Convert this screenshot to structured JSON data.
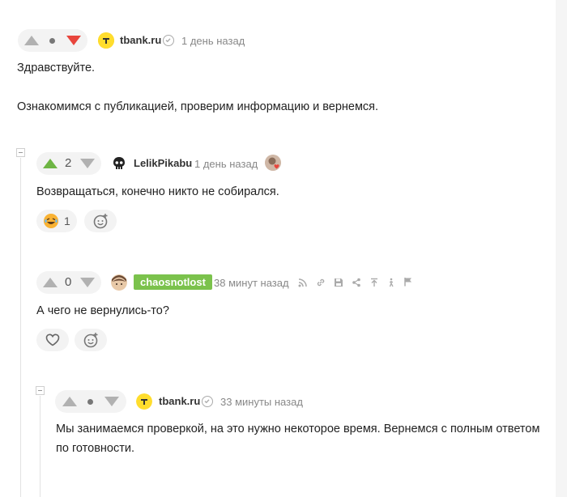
{
  "comments": [
    {
      "author": "tbank.ru",
      "time": "1 день назад",
      "verified": true,
      "paragraphs": [
        "Здравствуйте.",
        "Ознакомимся с публикацией, проверим информацию и вернемся."
      ]
    },
    {
      "author": "LelikPikabu",
      "time": "1 день назад",
      "rating": "2",
      "text": "Возвращаться, конечно никто не собирался.",
      "reaction_count": "1"
    },
    {
      "author": "chaosnotlost",
      "time": "38 минут назад",
      "rating": "0",
      "text": "А чего не вернулись-то?"
    },
    {
      "author": "tbank.ru",
      "time": "33 минуты назад",
      "verified": true,
      "text_line1": "Мы занимаемся проверкой, на это нужно некоторое время. Вернемся с полным ответом",
      "text_line2": "по готовности."
    }
  ],
  "colors": {
    "upvote": "#6eb544",
    "downvote": "#e8453c",
    "badge": "#7bc24c"
  }
}
